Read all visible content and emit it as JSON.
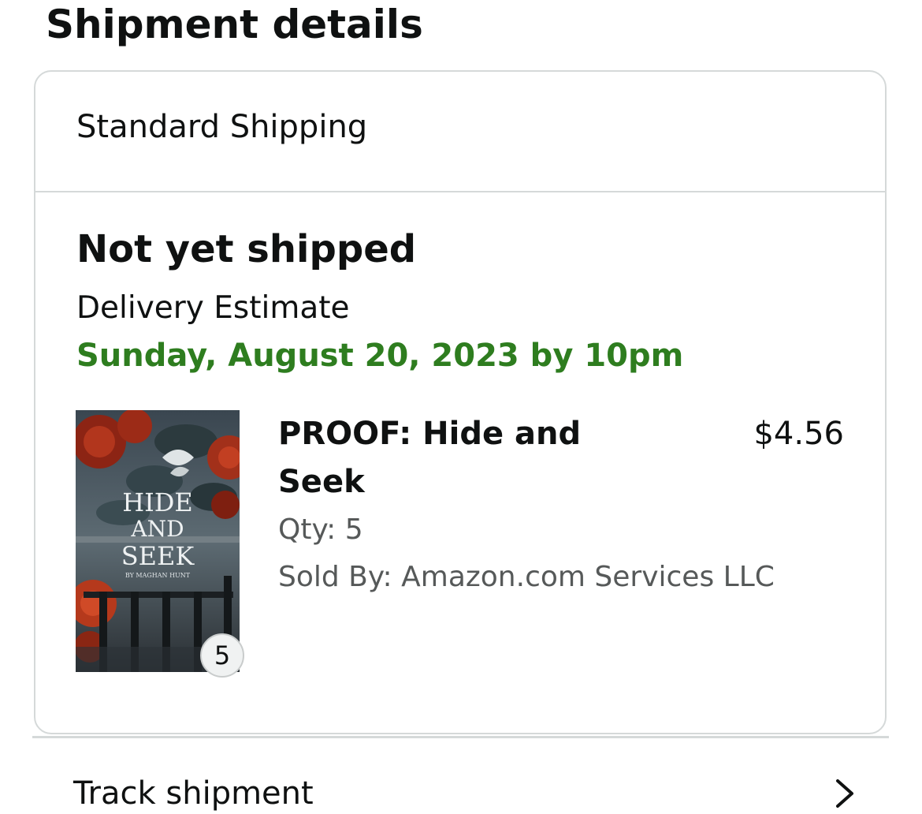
{
  "page_title": "Shipment details",
  "shipment": {
    "method": "Standard Shipping",
    "status": "Not yet shipped",
    "estimate_label": "Delivery Estimate",
    "estimate_date": "Sunday, August 20, 2023 by 10pm"
  },
  "item": {
    "title": "PROOF: Hide and Seek",
    "price": "$4.56",
    "qty_text": "Qty: 5",
    "seller_text": "Sold By: Amazon.com Services LLC",
    "qty_badge": "5",
    "cover_text_line1": "HIDE",
    "cover_text_line2": "AND",
    "cover_text_line3": "SEEK",
    "cover_author": "BY MAGHAN HUNT"
  },
  "actions": {
    "track_label": "Track shipment"
  },
  "colors": {
    "estimate_green": "#2e7d1f",
    "muted_text": "#565959",
    "border": "#d5d9d9"
  },
  "icons": {
    "track_chevron": "chevron-right-icon"
  }
}
